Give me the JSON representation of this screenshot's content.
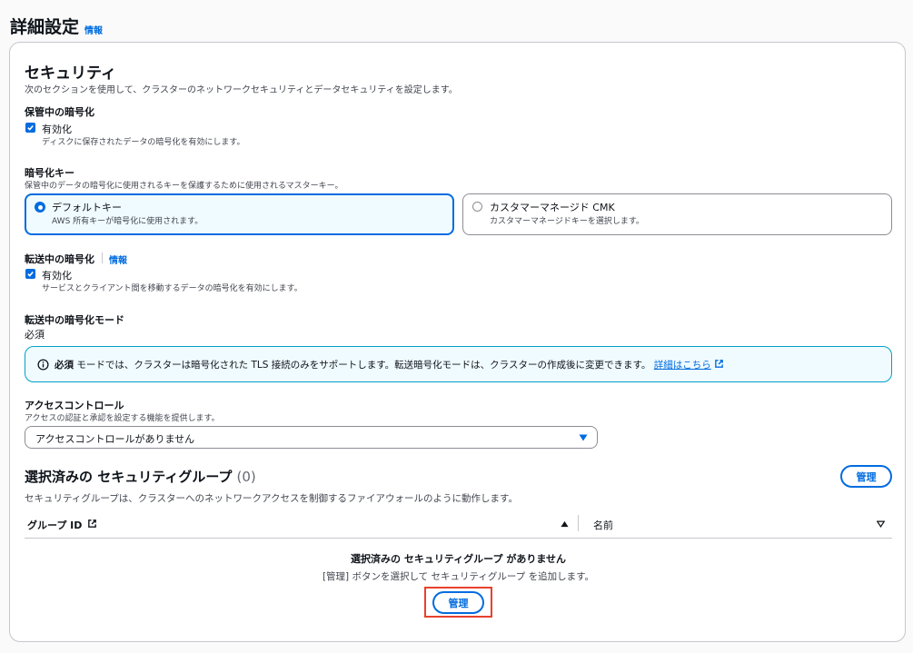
{
  "page": {
    "title": "詳細設定",
    "info": "情報"
  },
  "security": {
    "title": "セキュリティ",
    "description": "次のセクションを使用して、クラスターのネットワークセキュリティとデータセキュリティを設定します。"
  },
  "encryption_at_rest": {
    "label": "保管中の暗号化",
    "checkbox_label": "有効化",
    "checkbox_desc": "ディスクに保存されたデータの暗号化を有効にします。",
    "checked": true
  },
  "encryption_key": {
    "label": "暗号化キー",
    "description": "保管中のデータの暗号化に使用されるキーを保護するために使用されるマスターキー。",
    "options": [
      {
        "label": "デフォルトキー",
        "desc": "AWS 所有キーが暗号化に使用されます。",
        "selected": true
      },
      {
        "label": "カスタマーマネージド CMK",
        "desc": "カスタマーマネージドキーを選択します。",
        "selected": false
      }
    ]
  },
  "encryption_in_transit": {
    "label": "転送中の暗号化",
    "info": "情報",
    "checkbox_label": "有効化",
    "checkbox_desc": "サービスとクライアント間を移動するデータの暗号化を有効にします。",
    "checked": true
  },
  "transit_mode": {
    "label": "転送中の暗号化モード",
    "value": "必須",
    "alert_bold": "必須",
    "alert_text": "モードでは、クラスターは暗号化された TLS 接続のみをサポートします。転送暗号化モードは、クラスターの作成後に変更できます。",
    "alert_link": "詳細はこちら"
  },
  "access_control": {
    "label": "アクセスコントロール",
    "description": "アクセスの認証と承認を設定する機能を提供します。",
    "selected_value": "アクセスコントロールがありません"
  },
  "security_groups": {
    "title": "選択済みの セキュリティグループ",
    "count": "(0)",
    "manage_button": "管理",
    "description": "セキュリティグループは、クラスターへのネットワークアクセスを制御するファイアウォールのように動作します。",
    "columns": [
      "グループ ID",
      "名前"
    ],
    "empty_title": "選択済みの セキュリティグループ がありません",
    "empty_desc": "[管理] ボタンを選択して セキュリティグループ を追加します。",
    "empty_button": "管理"
  },
  "colors": {
    "accent": "#006ce0",
    "highlight": "#e8412c",
    "info_border": "#00a1c9"
  }
}
